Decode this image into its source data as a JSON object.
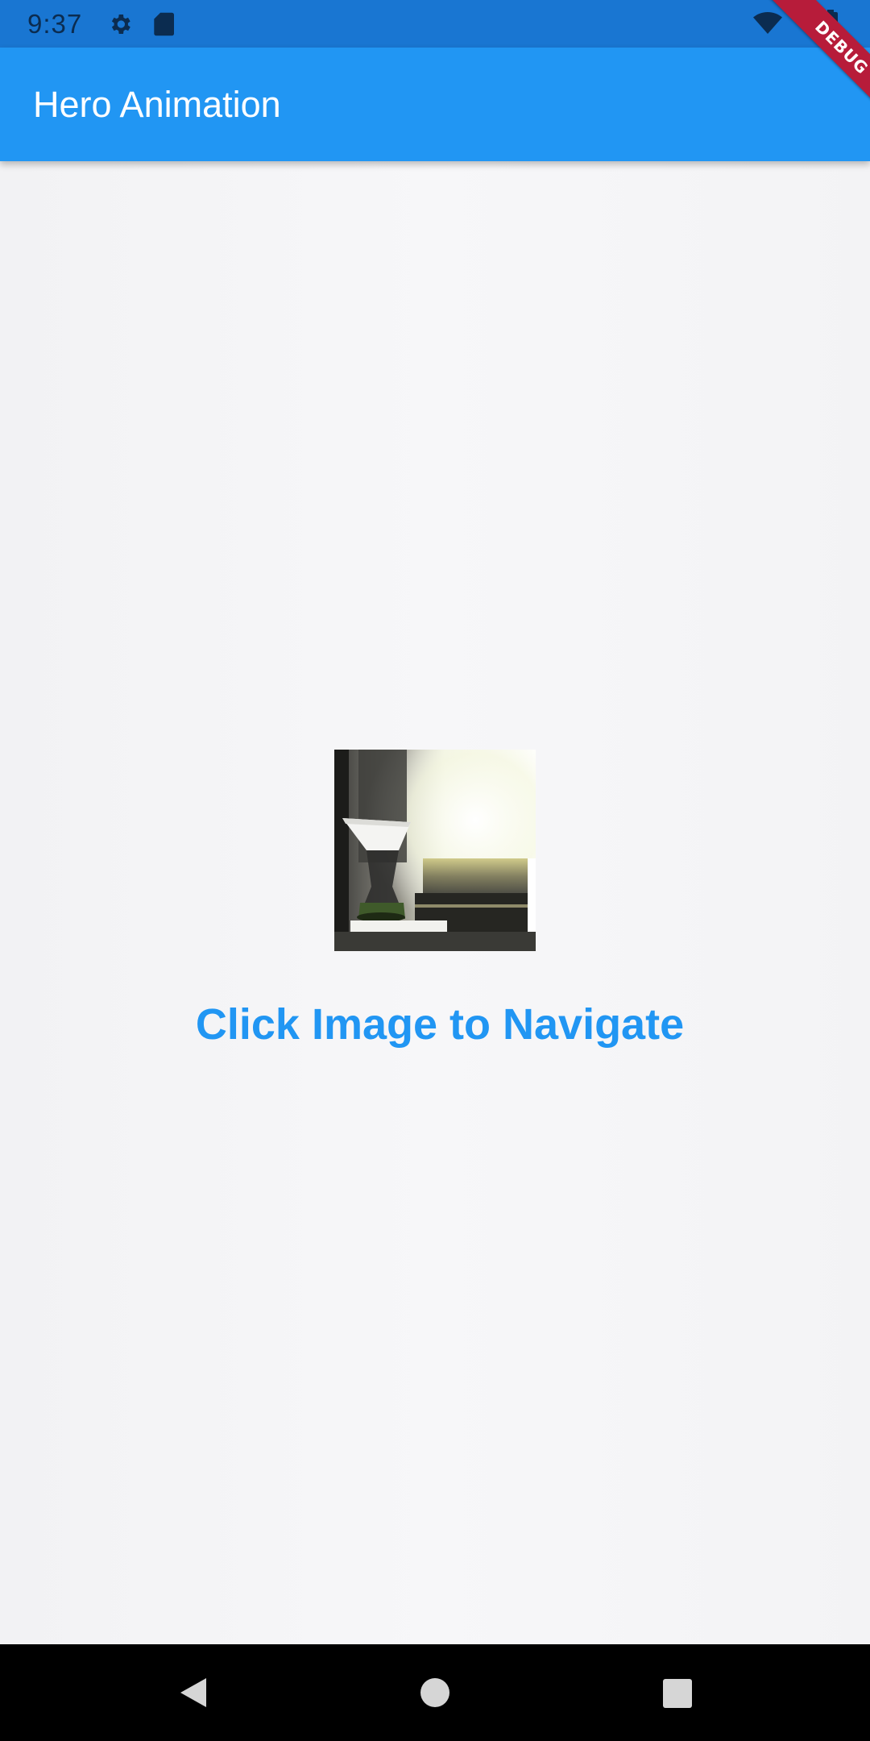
{
  "status_bar": {
    "time": "9:37",
    "icons": [
      "gear-icon",
      "sd-card-icon",
      "wifi-icon",
      "battery-icon"
    ],
    "background_color": "#1976d2"
  },
  "app_bar": {
    "title": "Hero Animation",
    "background_color": "#2196f3"
  },
  "debug_banner": {
    "label": "DEBUG"
  },
  "main": {
    "image": {
      "description_icon": "coffee-pour-over-photo"
    },
    "instruction": "Click Image to Navigate",
    "instruction_color": "#2196f3"
  },
  "navigation_bar": {
    "buttons": [
      "back-icon",
      "home-icon",
      "recents-icon"
    ]
  }
}
